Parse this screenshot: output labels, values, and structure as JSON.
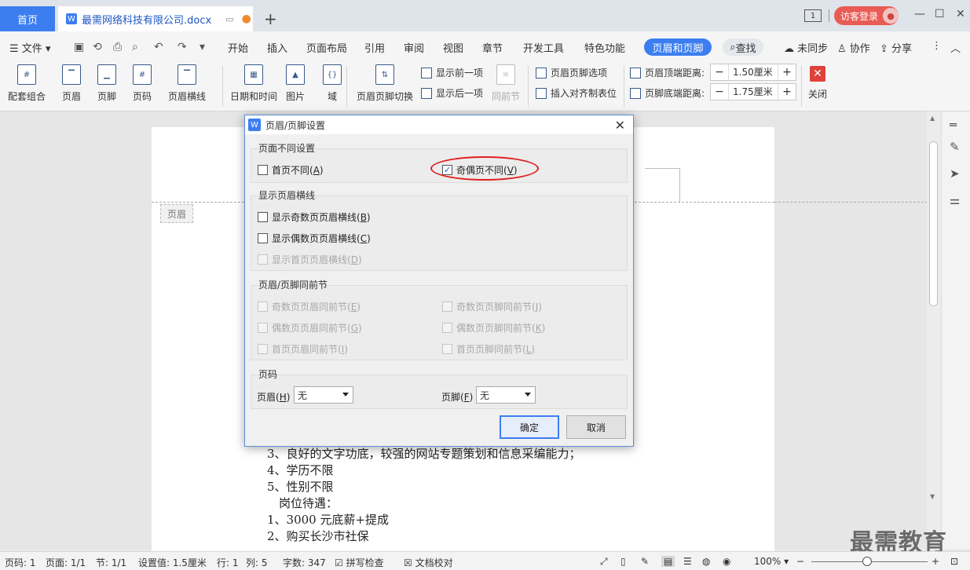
{
  "tabs": {
    "home": "首页",
    "doc_title": "最需网络科技有限公司.docx",
    "add": "+"
  },
  "titlebar": {
    "page_indicator": "1",
    "login": "访客登录",
    "minimize": "—",
    "restore": "☐",
    "close": "✕"
  },
  "menubar": {
    "file": "文件",
    "items": [
      "开始",
      "插入",
      "页面布局",
      "引用",
      "审阅",
      "视图",
      "章节",
      "开发工具",
      "特色功能"
    ],
    "active": "页眉和页脚",
    "find": "查找",
    "sync": "未同步",
    "collab": "协作",
    "share": "分享"
  },
  "ribbon": {
    "big": [
      "配套组合",
      "页眉",
      "页脚",
      "页码",
      "页眉横线",
      "日期和时间",
      "图片",
      "域",
      "页眉页脚切换"
    ],
    "show_prev": "显示前一项",
    "show_next": "显示后一项",
    "same_as_prev": "同前节",
    "options": "页眉页脚选项",
    "insert_tab": "插入对齐制表位",
    "header_top_label": "页眉顶端距离:",
    "header_top_value": "1.50厘米",
    "footer_bottom_label": "页脚底端距离:",
    "footer_bottom_value": "1.75厘米",
    "close": "关闭"
  },
  "document": {
    "header_label": "页眉",
    "lines": [
      "3、良好的文字功底，较强的网站专题策划和信息采编能力；",
      "4、学历不限",
      "5、性别不限",
      "　岗位待遇：",
      "1、3000 元底薪+提成",
      "2、购买长沙市社保"
    ]
  },
  "dialog": {
    "title": "页眉/页脚设置",
    "group1": "页面不同设置",
    "first_page_diff": "首页不同(",
    "first_page_key": "A",
    "odd_even_diff": "奇偶页不同(",
    "odd_even_key": "V",
    "group2": "显示页眉横线",
    "show_odd_line": "显示奇数页页眉横线(",
    "show_odd_key": "B",
    "show_even_line": "显示偶数页页眉横线(",
    "show_even_key": "C",
    "show_first_line": "显示首页页眉横线(",
    "show_first_key": "D",
    "group3": "页眉/页脚同前节",
    "odd_header_same": "奇数页页眉同前节(",
    "odd_header_key": "E",
    "odd_footer_same": "奇数页页脚同前节(",
    "odd_footer_key": "J",
    "even_header_same": "偶数页页眉同前节(",
    "even_header_key": "G",
    "even_footer_same": "偶数页页脚同前节(",
    "even_footer_key": "K",
    "first_header_same": "首页页眉同前节(",
    "first_header_key": "I",
    "first_footer_same": "首页页脚同前节(",
    "first_footer_key": "L",
    "group4": "页码",
    "header_label": "页眉(",
    "header_key": "H",
    "header_value": "无",
    "footer_label": "页脚(",
    "footer_key": "F",
    "footer_value": "无",
    "ok": "确定",
    "cancel": "取消"
  },
  "statusbar": {
    "page": "页码: 1",
    "pages": "页面: 1/1",
    "section": "节: 1/1",
    "setting": "设置值: 1.5厘米",
    "row": "行: 1",
    "col": "列: 5",
    "words": "字数: 347",
    "spell": "拼写检查",
    "proof": "文档校对",
    "zoom": "100%"
  },
  "watermark": "最需教育",
  "colors": {
    "accent": "#3c7ef0",
    "highlight_ellipse": "#e02020",
    "login": "#e85c55"
  }
}
